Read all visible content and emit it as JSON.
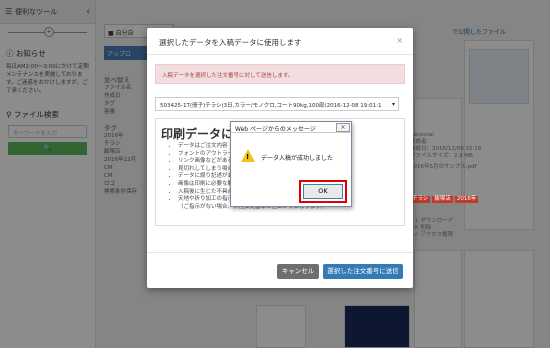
{
  "sidebar": {
    "header_label": "便利なツール",
    "notice_title": "お知らせ",
    "notice_text": "毎日AM2:00～3:00にかけて定期メンテナンスを実施しております。ご迷惑をおかけしますが、ご了承ください。",
    "file_search_title": "ファイル検索",
    "search_placeholder": "キーワードを入力"
  },
  "main": {
    "self_file_tab": "自分自",
    "upload_button": "アップロ",
    "share_link": "で公開したファイル",
    "sort_label": "並べ替え",
    "filters": [
      "ファイル名",
      "作成日",
      "タグ",
      "容量"
    ],
    "tag_title": "タグ",
    "tags": [
      "2016年",
      "チラシ",
      "飯塚店",
      "2016年12月",
      "CM",
      "CM",
      "ロゴ",
      "検索条件保存"
    ]
  },
  "cards": {
    "right_text": [
      "personal",
      "作成者：",
      "作成日：2016/12/08 15:18",
      "ファイルサイズ：2.9 MB",
      "2016年5月のサンプル.pdf"
    ],
    "tags": [
      "チラシ",
      "飯塚店",
      "2016年"
    ],
    "download": "ダウンロード",
    "delete": "削除",
    "access": "アクセス権限"
  },
  "modal": {
    "title": "選択したデータを入稿データに使用します",
    "close": "×",
    "alert": "入稿データを選択した注文番号に対して送信します。",
    "select_value": "503425-1T(冊子)チラシ(3日,カラー/モノクロ,コート90kg,100部(2016-12-08 19:01:1",
    "inner_title": "印刷データに関",
    "inner_list": [
      "データはご注文内容",
      "フォントのアウトライ",
      "リンク画像などがある",
      "見切れしてしまう場合",
      "データに誤り記述があ",
      "画像は印刷に必要な解",
      "入稿後に生じた不具合",
      "天地や折り加工の指示",
      "（ご指示がない場合、弊社推奨基準の仕上がりとなります）"
    ],
    "cancel_label": "キャンセル",
    "send_label": "選択した注文番号に送信"
  },
  "dialog": {
    "title": "Web ページからのメッセージ",
    "close": "×",
    "message": "データ入稿が成功しました",
    "ok_label": "OK"
  }
}
